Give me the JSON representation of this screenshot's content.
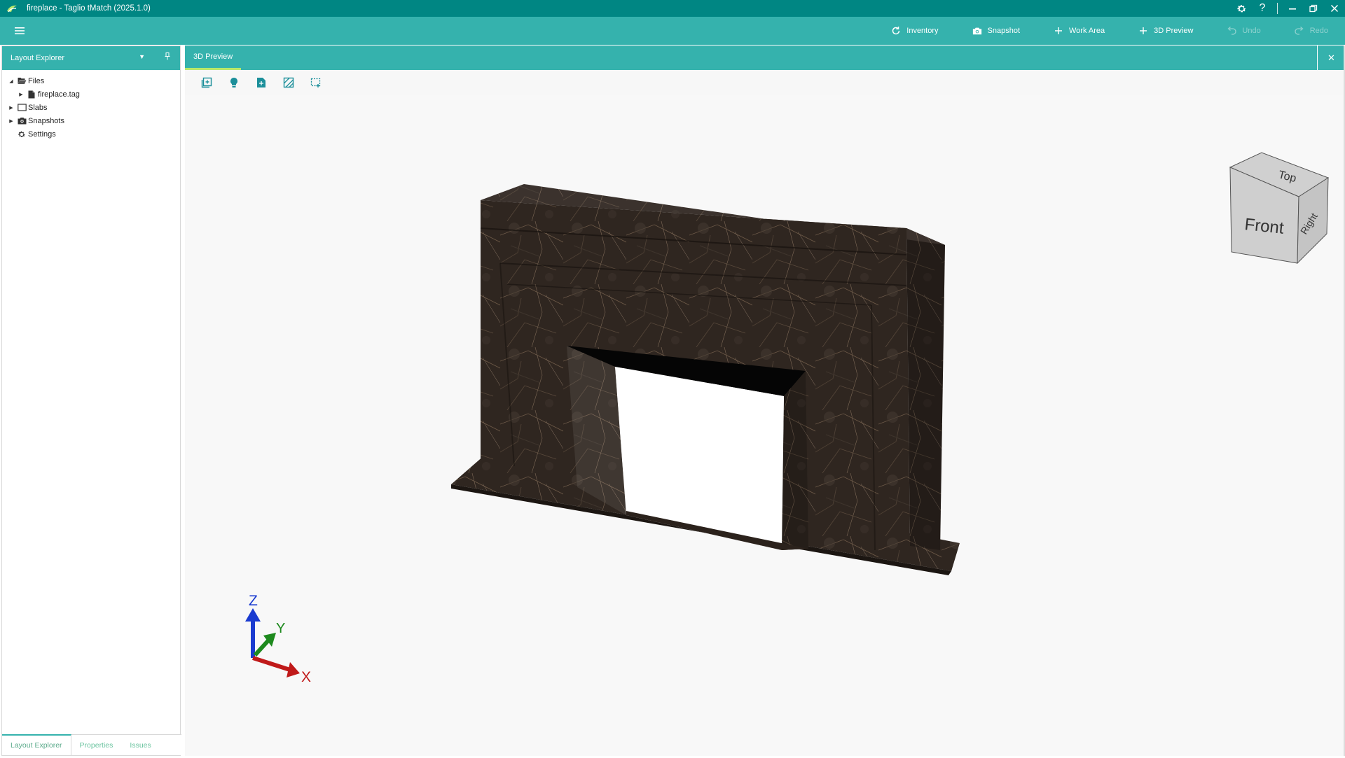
{
  "window": {
    "title": "fireplace - Taglio tMatch (2025.1.0)"
  },
  "toolbar": {
    "inventory_label": "Inventory",
    "snapshot_label": "Snapshot",
    "work_area_label": "Work Area",
    "preview_label": "3D Preview",
    "undo_label": "Undo",
    "redo_label": "Redo"
  },
  "left_panel": {
    "title": "Layout Explorer",
    "tree": [
      {
        "label": "Files",
        "icon": "folder-open-icon",
        "expanded": true
      },
      {
        "label": "fireplace.tag",
        "icon": "file-icon"
      },
      {
        "label": "Slabs",
        "icon": "slab-icon"
      },
      {
        "label": "Snapshots",
        "icon": "camera-icon"
      },
      {
        "label": "Settings",
        "icon": "gear-icon"
      }
    ],
    "tabs": [
      "Layout Explorer",
      "Properties",
      "Issues"
    ]
  },
  "preview": {
    "tab_label": "3D Preview",
    "view_cube": {
      "top": "Top",
      "front": "Front",
      "right": "Right"
    },
    "axes": {
      "x": "X",
      "y": "Y",
      "z": "Z"
    }
  },
  "colors": {
    "titlebar": "#008683",
    "toolbar": "#35b2ad",
    "tab_underline": "#b9e86a",
    "marble": "#2f2620"
  }
}
